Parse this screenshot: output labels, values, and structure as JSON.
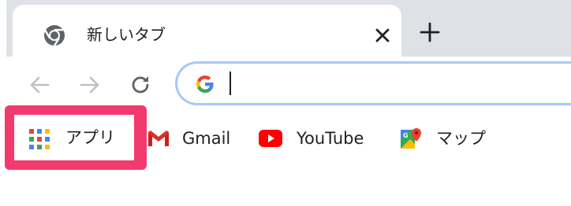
{
  "tab": {
    "title": "新しいタブ",
    "favicon_icon": "chrome-icon",
    "close_icon": "close-icon"
  },
  "new_tab": {
    "icon": "plus-icon"
  },
  "toolbar": {
    "back_icon": "arrow-left-icon",
    "forward_icon": "arrow-right-icon",
    "reload_icon": "reload-icon"
  },
  "omnibox": {
    "icon": "google-g-icon",
    "value": "",
    "placeholder": ""
  },
  "bookmarks": {
    "apps_label": "アプリ",
    "items": [
      {
        "label": "Gmail",
        "icon": "gmail-icon"
      },
      {
        "label": "YouTube",
        "icon": "youtube-icon"
      },
      {
        "label": "マップ",
        "icon": "google-maps-icon"
      }
    ]
  },
  "colors": {
    "highlight": "#f23a6e",
    "tab_strip": "#dee1e6",
    "omnibox_border": "#a8c7fa"
  }
}
